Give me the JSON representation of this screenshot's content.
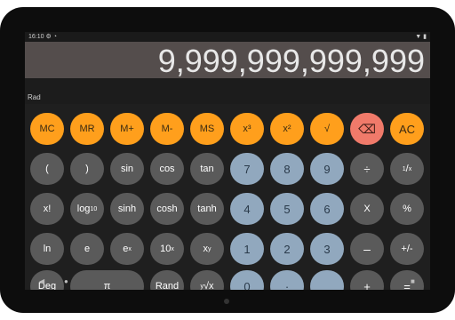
{
  "status": {
    "time": "16:10",
    "left_icons": "⚙ ◔",
    "right_icons": "▼ ▮"
  },
  "display": {
    "value": "9,999,999,999,999",
    "mode": "Rad"
  },
  "keys": {
    "mc": "MC",
    "mr": "MR",
    "mplus": "M+",
    "mminus": "M-",
    "ms": "MS",
    "cube": "x³",
    "square": "x²",
    "sqrt": "√",
    "backspace": "⌫",
    "ac": "AC",
    "lparen": "(",
    "rparen": ")",
    "sin": "sin",
    "cos": "cos",
    "tan": "tan",
    "n7": "7",
    "n8": "8",
    "n9": "9",
    "div": "÷",
    "recip_num": "1",
    "recip_den": "x",
    "fact": "x!",
    "log10_base": "log",
    "log10_sub": "10",
    "sinh": "sinh",
    "cosh": "cosh",
    "tanh": "tanh",
    "n4": "4",
    "n5": "5",
    "n6": "6",
    "mul": "X",
    "pct": "%",
    "ln": "ln",
    "e": "e",
    "ex_base": "e",
    "ex_sup": "x",
    "tenx_base": "10",
    "tenx_sup": "x",
    "xy_base": "x",
    "xy_sup": "y",
    "n1": "1",
    "n2": "2",
    "n3": "3",
    "minus": "–",
    "plusminus": "+/-",
    "deg": "Deg",
    "pi": "π",
    "rand": "Rand",
    "yroot_sup": "y",
    "yroot_rest": "√x",
    "n0": "0",
    "dot": "·",
    "plus": "+",
    "equals": "="
  },
  "nav": {
    "back": "◀",
    "home": "●",
    "recents": "■"
  },
  "colors": {
    "orange": "#ff9f1c",
    "red": "#f07a6a",
    "blue": "#91a8be",
    "dark": "#5a5a5a"
  }
}
